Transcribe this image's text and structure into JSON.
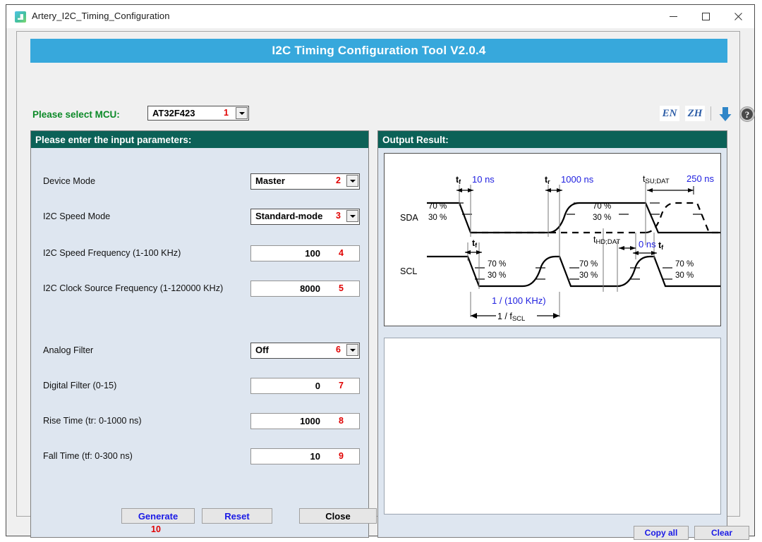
{
  "window": {
    "title": "Artery_I2C_Timing_Configuration",
    "icon": "app-icon",
    "controls": {
      "minimize": "minimize-icon",
      "maximize": "maximize-icon",
      "close": "close-icon"
    }
  },
  "banner": {
    "title": "I2C Timing Configuration Tool V2.0.4",
    "color": "#37a8dc"
  },
  "mcu": {
    "label": "Please select MCU:",
    "value": "AT32F423",
    "annotation": "1",
    "label_color": "#0c8a28"
  },
  "tool_icons": {
    "en": "EN",
    "zh": "ZH",
    "download": "download-icon",
    "help": "help-icon"
  },
  "left_panel": {
    "title": "Please enter the input parameters:",
    "rows": [
      {
        "label": "Device Mode",
        "value": "Master",
        "annotation": "2",
        "kind": "select"
      },
      {
        "label": "I2C Speed Mode",
        "value": "Standard-mode",
        "annotation": "3",
        "kind": "select"
      },
      {
        "label": "I2C Speed Frequency (1-100 KHz)",
        "value": "100",
        "annotation": "4",
        "kind": "text"
      },
      {
        "label": "I2C Clock Source Frequency (1-120000 KHz)",
        "value": "8000",
        "annotation": "5",
        "kind": "text"
      },
      {
        "label": "Analog Filter",
        "value": "Off",
        "annotation": "6",
        "kind": "select"
      },
      {
        "label": "Digital Filter (0-15)",
        "value": "0",
        "annotation": "7",
        "kind": "text"
      },
      {
        "label": "Rise Time (tr: 0-1000 ns)",
        "value": "1000",
        "annotation": "8",
        "kind": "text"
      },
      {
        "label": "Fall Time (tf: 0-300 ns)",
        "value": "10",
        "annotation": "9",
        "kind": "text"
      }
    ],
    "buttons": {
      "generate": "Generate",
      "generate_annotation": "10",
      "reset": "Reset",
      "close": "Close"
    }
  },
  "right_panel": {
    "title": "Output Result:",
    "output_text": "",
    "buttons": {
      "copy_all": "Copy all",
      "clear": "Clear"
    }
  },
  "timing_diagram": {
    "signals": {
      "sda": "SDA",
      "scl": "SCL"
    },
    "levels": {
      "high": "70 %",
      "low": "30 %"
    },
    "labels": {
      "tf_sym": "t",
      "tf_sub": "f",
      "tr_sub": "r",
      "tsu_dat": "t",
      "tsu_dat_sub": "SU;DAT",
      "thd_dat": "t",
      "thd_dat_sub": "HD;DAT",
      "fscl_prefix": "1 / f",
      "fscl_sub": "SCL"
    },
    "values": {
      "fall_time": "10 ns",
      "rise_time": "1000 ns",
      "setup_time": "250 ns",
      "hold_time": "0 ns",
      "scl_period": "1 / (100 KHz)"
    },
    "value_color": "#2020e0"
  }
}
